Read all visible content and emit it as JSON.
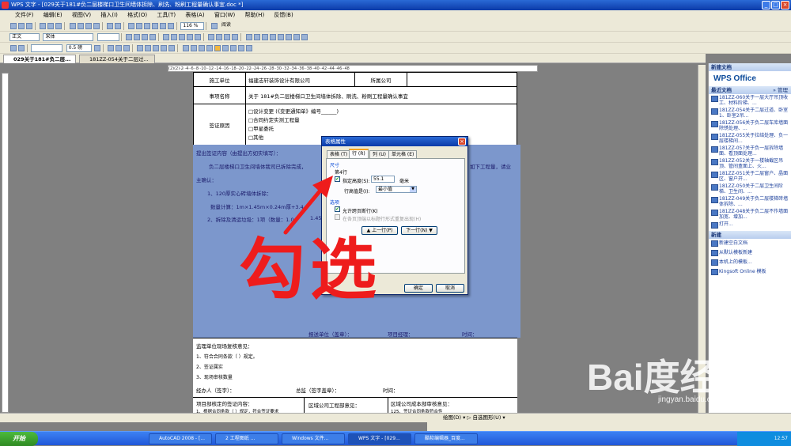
{
  "window": {
    "title": "WPS 文字 - [029关于181#负二层楼梯口卫生间墙体拆除、刷洗、粉刷工程量确认事宜.doc *]",
    "controls": [
      "_",
      "□",
      "×"
    ]
  },
  "menu": {
    "items": [
      "文件(F)",
      "编辑(E)",
      "视图(V)",
      "插入(I)",
      "格式(O)",
      "工具(T)",
      "表格(A)",
      "窗口(W)",
      "帮助(H)",
      "反馈(B)"
    ]
  },
  "toolbar": {
    "zoom": "116 %",
    "read_label": "阅读",
    "style": "正文",
    "font": "宋体",
    "line_width": "0.5 磅"
  },
  "tabs": [
    {
      "label": "029关于181#负二层..."
    },
    {
      "label": "181ZZ-054关于二层过..."
    }
  ],
  "ruler": {
    "ticks": "(2)(2)·2··4··6··8··10··12··14··16··18··20··22··24··26··28··30··32··34··36··38··40··42··44··46··48"
  },
  "document": {
    "rows": [
      {
        "label": "施工单位",
        "value": "福建志轩装饰设计有限公司",
        "label2": "所属公司",
        "value2": ""
      },
      {
        "label": "事项名称",
        "value": "关于 181#负二层楼梯口卫生间墙体拆除、刷洗、粉刷工程量确认事宜"
      }
    ],
    "reason_label": "签证原因",
    "reasons": [
      "□设计变更 (《变更通知单》编号______)",
      "□合同约定实测工程量",
      "□甲星委托",
      "□其他"
    ],
    "body_heading": "提出签证内容（由提出方如实填写）：",
    "body_line1": "负二层楼梯口卫生间墙体我司已拆除完成，",
    "body_line1_tail": "如下工程量，请业",
    "body_line2": "主确认：",
    "item1": "1、120厚实心砖墙体拆除：",
    "item1_calc": "数量计算：1m×1.45m×0.24m厚+3.4",
    "item2": "2、拆除及清运垃圾：1项（数量：1.0",
    "item2_tail": "1.45",
    "sign_line": {
      "submitter": "报送单位（盖章）：",
      "manager": "项目经理：",
      "date": "时间："
    },
    "supervisor_heading": "监理单位现场复核意见：",
    "supervisor_items": [
      "1、符合合同条款（     ）规定。",
      "2、签证属实",
      "3、现场审核数量"
    ],
    "handler_line": {
      "handler": "经办人（签字）：",
      "chief": "总监（签字盖章）：",
      "time": "时间："
    },
    "bottom_cols": [
      {
        "heading": "项目部核定的签证内容：",
        "line": "1、根据合同条款（     ）规定，符合签证要求"
      },
      {
        "heading": "区域公司工程部意见：",
        "line": ""
      },
      {
        "heading": "区域公司成本部审核意见：",
        "line": "125、签证合同条款符合性"
      }
    ]
  },
  "dialog": {
    "title": "表格属性",
    "tabs": [
      "表格 (T)",
      "行 (R)",
      "列 (U)",
      "单元格 (E)"
    ],
    "size_section": "尺寸",
    "row_label": "第4行",
    "specify_height_label": "指定高度(S):",
    "height_value": "55.1",
    "unit": "毫米",
    "row_height_label": "行高值是(I):",
    "row_height_mode": "最小值",
    "options_section": "选项",
    "allow_break_label": "允许跨页断行(K)",
    "repeat_header_label": "在各页顶端以标题行形式重复出现(H)",
    "prev_row_button": "▲ 上一行(P)",
    "next_row_button": "下一行(N) ▼",
    "ok_button": "确定",
    "cancel_button": "取消",
    "specify_height_checked": true,
    "allow_break_checked": true
  },
  "annotation": {
    "text": "勾选",
    "color": "#ee1c1c"
  },
  "taskpane": {
    "title": "新建文档",
    "logo": "WPS Office",
    "recent_heading": "最近文档",
    "manage": "» 管理",
    "recent_docs": [
      "181ZZ-060关于一层大厅吊顶收工、材料阶梯、...",
      "181ZZ-054关于二层过道、卧室1、卧室2吊...",
      "181ZZ-056关于负二层车库墙面除锈处理、...",
      "181ZZ-055关于拉结处理、负一层楼梯间...",
      "181ZZ-057关于负一层拆除墙面、看顶面处理...",
      "181ZZ-052关于一楼轴截区吊顶、管间盒面上、火...",
      "181ZZ-051关于二层窗户、晶面区、窗户开...",
      "181ZZ-050关于二层卫生间阶梯、卫生间、...",
      "181ZZ-049关于负二层楼梯砖墙体拆除、...",
      "181ZZ-048关于负二层不作墙面加宽、增加...",
      "打开..."
    ],
    "new_heading": "新建",
    "new_items": [
      "新建空白文档",
      "从默认模板新建",
      "本机上的模板...",
      "Kingsoft Online 模板"
    ]
  },
  "statusbar": {
    "text": "绘图(D) ▾  ▷  自选图形(U) ▾"
  },
  "taskbar": {
    "start": "开始",
    "items": [
      "AutoCAD 2008 - [...",
      "2 工程图纸 ...",
      "Windows 文件...",
      "WPS 文字 - [029...",
      "酷软编辑器_百度..."
    ],
    "clock": "12:57"
  },
  "watermark": {
    "logo": "Bai度经验",
    "url": "jingyan.baidu.com"
  }
}
